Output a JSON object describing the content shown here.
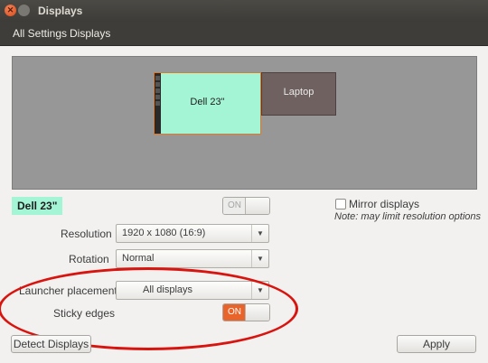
{
  "window": {
    "title": "Displays"
  },
  "nav": {
    "all_settings": "All Settings",
    "current": "Displays"
  },
  "preview": {
    "monitors": [
      {
        "label": "Dell 23\"",
        "selected": true
      },
      {
        "label": "Laptop",
        "selected": false
      }
    ]
  },
  "selected_display": {
    "name": "Dell 23\"",
    "power_toggle": {
      "label": "ON",
      "state": "disabled"
    }
  },
  "mirror": {
    "label": "Mirror displays",
    "checked": false,
    "note": "Note: may limit resolution options"
  },
  "settings": {
    "resolution": {
      "label": "Resolution",
      "value": "1920 x 1080 (16:9)"
    },
    "rotation": {
      "label": "Rotation",
      "value": "Normal"
    },
    "launcher": {
      "label": "Launcher placement",
      "value": "All displays"
    },
    "sticky": {
      "label": "Sticky edges",
      "toggle_label": "ON",
      "state": "on"
    }
  },
  "buttons": {
    "detect": "Detect Displays",
    "apply": "Apply"
  },
  "colors": {
    "selected_monitor": "#a4f5d6",
    "accent_orange": "#e9642a",
    "annotation_red": "#d9140f",
    "titlebar": "#3e3d39"
  }
}
